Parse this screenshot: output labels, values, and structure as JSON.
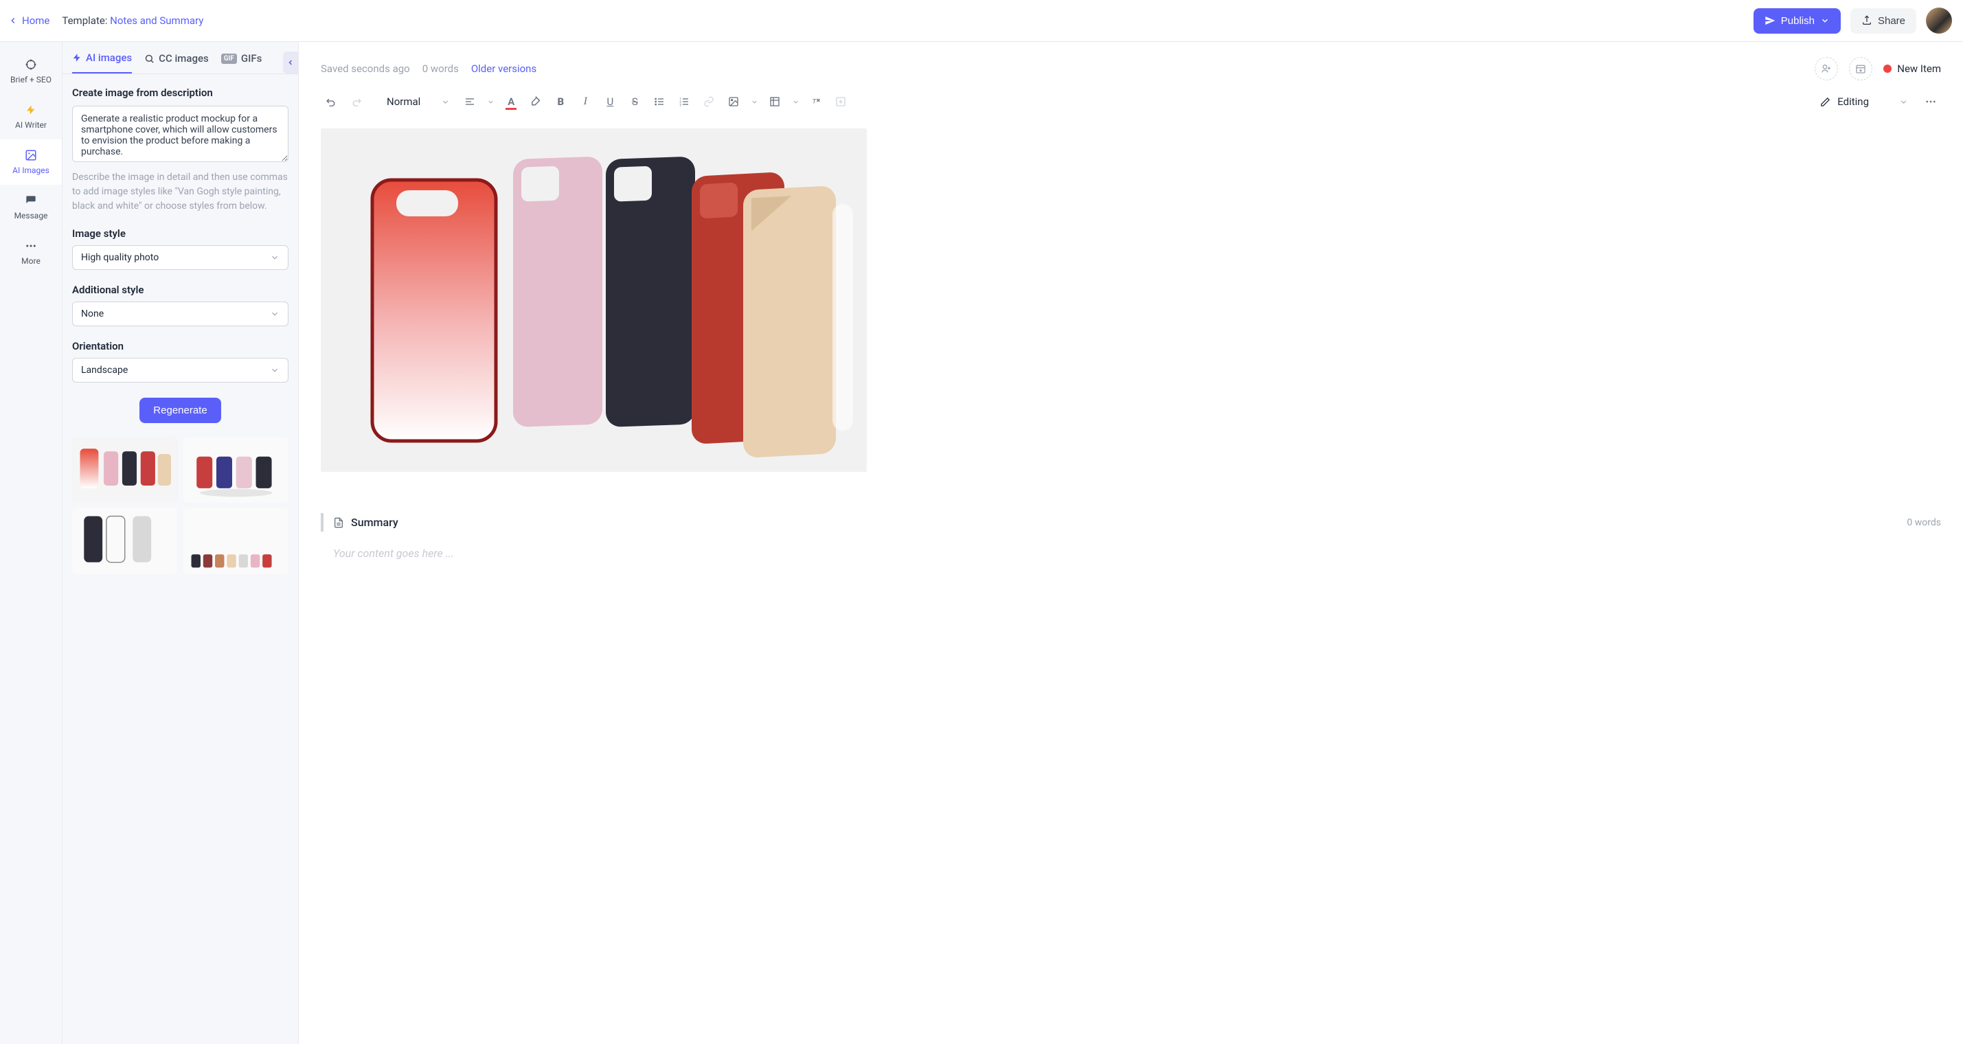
{
  "topbar": {
    "home": "Home",
    "template_prefix": "Template: ",
    "template_name": "Notes and Summary",
    "publish": "Publish",
    "share": "Share"
  },
  "leftnav": {
    "items": [
      {
        "label": "Brief + SEO"
      },
      {
        "label": "AI Writer"
      },
      {
        "label": "AI Images"
      },
      {
        "label": "Message"
      },
      {
        "label": "More"
      }
    ],
    "active_index": 2
  },
  "tabs": {
    "items": [
      {
        "label": "AI images"
      },
      {
        "label": "CC images"
      },
      {
        "label": "GIFs",
        "badge": "GIF"
      }
    ],
    "active_index": 0
  },
  "panel": {
    "create_title": "Create image from description",
    "prompt_value": "Generate a realistic product mockup for a smartphone cover, which will allow customers to envision the product before making a purchase.",
    "help_text": "Describe the image in detail and then use commas to add image styles like \"Van Gogh style painting, black and white\" or choose styles from below.",
    "style_label": "Image style",
    "style_value": "High quality photo",
    "additional_label": "Additional style",
    "additional_value": "None",
    "orientation_label": "Orientation",
    "orientation_value": "Landscape",
    "regenerate": "Regenerate"
  },
  "editor": {
    "saved": "Saved seconds ago",
    "word_count": "0 words",
    "older": "Older versions",
    "new_item": "New Item",
    "format": "Normal",
    "editing": "Editing",
    "summary_title": "Summary",
    "summary_words": "0 words",
    "placeholder": "Your content goes here ..."
  },
  "colors": {
    "primary": "#5b5ff9",
    "danger": "#ef4444"
  }
}
